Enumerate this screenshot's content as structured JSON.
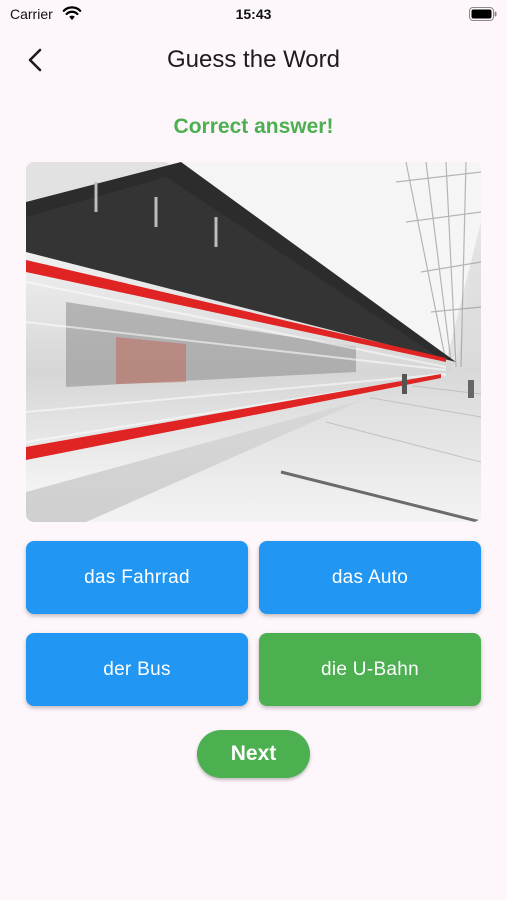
{
  "status_bar": {
    "carrier": "Carrier",
    "time": "15:43"
  },
  "app_bar": {
    "title": "Guess the Word",
    "back_icon": "chevron-left-icon"
  },
  "feedback": {
    "text": "Correct answer!",
    "color": "#4caf50"
  },
  "picture": {
    "subject": "train"
  },
  "answers": [
    {
      "label": "das Fahrrad",
      "state": "default",
      "color": "#2196f3"
    },
    {
      "label": "das Auto",
      "state": "default",
      "color": "#2196f3"
    },
    {
      "label": "der Bus",
      "state": "default",
      "color": "#2196f3"
    },
    {
      "label": "die U-Bahn",
      "state": "correct",
      "color": "#4caf50"
    }
  ],
  "next_button": {
    "label": "Next"
  }
}
